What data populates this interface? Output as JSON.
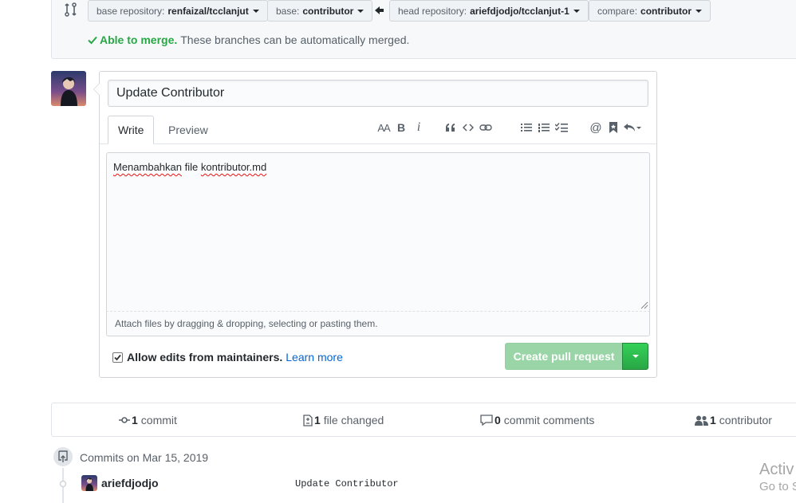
{
  "compare": {
    "base_repo_label": "base repository:",
    "base_repo_value": "renfaizal/tcclanjut",
    "base_label": "base:",
    "base_value": "contributor",
    "head_repo_label": "head repository:",
    "head_repo_value": "ariefdjodjo/tcclanjut-1",
    "compare_label": "compare:",
    "compare_value": "contributor",
    "merge_ok": "Able to merge.",
    "merge_text": "These branches can be automatically merged."
  },
  "form": {
    "title_value": "Update Contributor",
    "tab_write": "Write",
    "tab_preview": "Preview",
    "body_word1": "Menambahkan",
    "body_word2": " file ",
    "body_word3": "kontributor.md",
    "attach_hint": "Attach files by dragging & dropping, selecting or pasting them.",
    "allow_edits_label": "Allow edits from maintainers.",
    "learn_more": "Learn more",
    "create_button": "Create pull request"
  },
  "toolbar": {
    "header": "AA",
    "bold": "B",
    "italic": "i",
    "mention": "@"
  },
  "summary": {
    "commits_count": "1",
    "commits_label": "commit",
    "files_count": "1",
    "files_label": "file changed",
    "comments_count": "0",
    "comments_label": "commit comments",
    "contributors_count": "1",
    "contributors_label": "contributor"
  },
  "commits": {
    "date_heading": "Commits on Mar 15, 2019",
    "items": [
      {
        "author": "ariefdjodjo",
        "message": "Update Contributor"
      }
    ]
  },
  "watermark": {
    "line1": "Activ",
    "line2": "Go to S"
  },
  "colors": {
    "success_green": "#28a745",
    "link_blue": "#0366d6",
    "muted": "#586069"
  }
}
